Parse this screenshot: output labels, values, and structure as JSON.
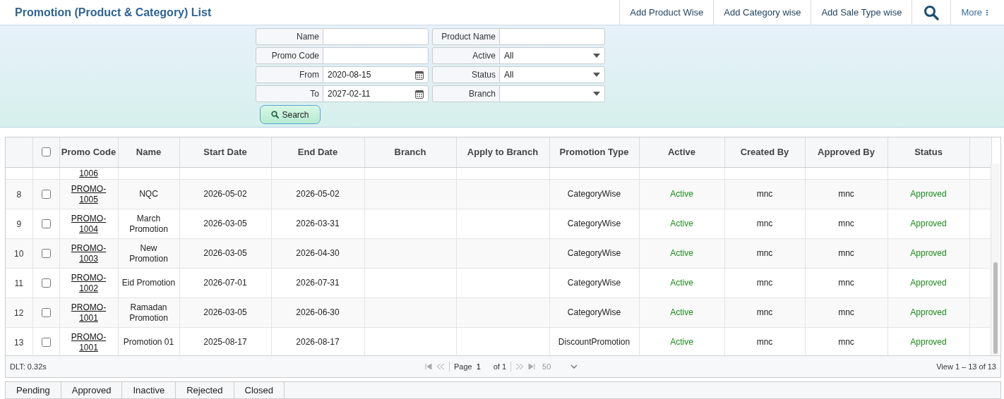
{
  "title": "Promotion (Product & Category) List",
  "toolbar": [
    "Add Product Wise",
    "Add Category wise",
    "Add Sale Type wise"
  ],
  "more": "More",
  "filters": [
    {
      "label": "Name",
      "kind": "text"
    },
    {
      "label": "Product Name",
      "kind": "text"
    },
    {
      "label": "Promo Code",
      "kind": "text"
    },
    {
      "label": "Active",
      "kind": "select",
      "value": "All"
    },
    {
      "label": "From",
      "kind": "date",
      "value": "2020-08-15"
    },
    {
      "label": "Status",
      "kind": "select",
      "value": "All"
    },
    {
      "label": "To",
      "kind": "date",
      "value": "2027-02-11"
    },
    {
      "label": "Branch",
      "kind": "select"
    }
  ],
  "search_button": "Search",
  "table": {
    "columns": [
      "Promo Code",
      "Name",
      "Start Date",
      "End Date",
      "Branch",
      "Apply to Branch",
      "Promotion Type",
      "Active",
      "Created By",
      "Approved By",
      "Status"
    ],
    "select_all_checked": false,
    "partial_row": {
      "promo_code": "1006"
    },
    "rows": [
      {
        "number": "8",
        "checked": false,
        "promo_code": "PROMO-1005",
        "name": "NQC",
        "start": "2026-05-02",
        "end": "2026-05-02",
        "type": "CategoryWise",
        "active": "Active",
        "created_by": "mnc",
        "approved_by": "mnc",
        "status": "Approved"
      },
      {
        "number": "9",
        "checked": false,
        "promo_code": "PROMO-1004",
        "name": "March Promotion",
        "start": "2026-03-05",
        "end": "2026-03-31",
        "type": "CategoryWise",
        "active": "Active",
        "created_by": "mnc",
        "approved_by": "mnc",
        "status": "Approved"
      },
      {
        "number": "10",
        "checked": false,
        "promo_code": "PROMO-1003",
        "name": "New Promotion",
        "start": "2026-03-05",
        "end": "2026-04-30",
        "type": "CategoryWise",
        "active": "Active",
        "created_by": "mnc",
        "approved_by": "mnc",
        "status": "Approved"
      },
      {
        "number": "11",
        "checked": false,
        "promo_code": "PROMO-1002",
        "name": "Eid Promotion",
        "start": "2026-07-01",
        "end": "2026-07-31",
        "type": "CategoryWise",
        "active": "Active",
        "created_by": "mnc",
        "approved_by": "mnc",
        "status": "Approved"
      },
      {
        "number": "12",
        "checked": false,
        "promo_code": "PROMO-1001",
        "name": "Ramadan Promotion",
        "start": "2026-03-05",
        "end": "2026-06-30",
        "type": "CategoryWise",
        "active": "Active",
        "created_by": "mnc",
        "approved_by": "mnc",
        "status": "Approved"
      },
      {
        "number": "13",
        "checked": false,
        "promo_code": "PROMO-1001",
        "name": "Promotion 01",
        "start": "2025-08-17",
        "end": "2026-08-17",
        "type": "DiscountPromotion",
        "active": "Active",
        "created_by": "mnc",
        "approved_by": "mnc",
        "status": "Approved"
      }
    ]
  },
  "pager": {
    "load_time": "DLT: 0.32s",
    "page_label": "Page",
    "page": "1",
    "of": "of 1",
    "page_size": "50",
    "view": "View 1 – 13 of 13"
  },
  "status_tabs": [
    {
      "label": "Pending",
      "selected": false
    },
    {
      "label": "Approved",
      "selected": false
    },
    {
      "label": "Inactive",
      "selected": false
    },
    {
      "label": "Rejected",
      "selected": false
    },
    {
      "label": "Closed",
      "selected": false
    }
  ]
}
